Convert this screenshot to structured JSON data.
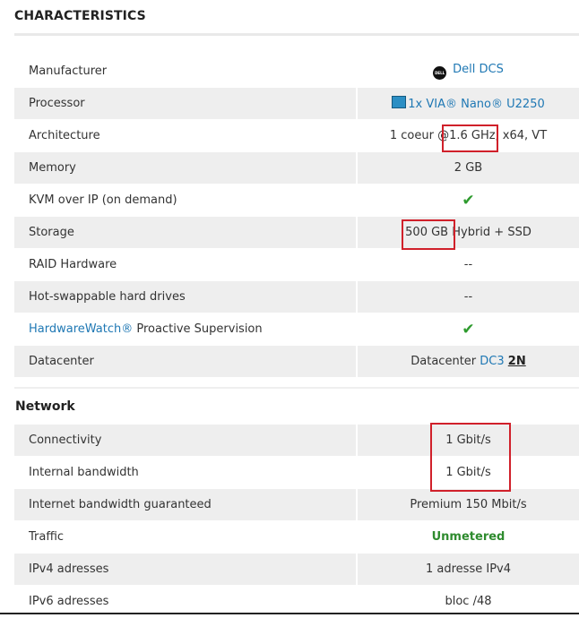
{
  "title": "CHARACTERISTICS",
  "specs": [
    {
      "label": "Manufacturer",
      "value": "Dell DCS"
    },
    {
      "label": "Processor",
      "value": "1x VIA® Nano® U2250"
    },
    {
      "label": "Architecture",
      "value": "1 coeur @1.6 GHz, x64, VT"
    },
    {
      "label": "Memory",
      "value": "2 GB"
    },
    {
      "label": "KVM over IP (on demand)",
      "value": "✔"
    },
    {
      "label": "Storage",
      "value": "500 GB Hybrid + SSD"
    },
    {
      "label": "RAID Hardware",
      "value": "--"
    },
    {
      "label": "Hot-swappable hard drives",
      "value": "--"
    },
    {
      "label": "Proactive Supervision",
      "link": "HardwareWatch®",
      "value": "✔"
    },
    {
      "label": "Datacenter",
      "value_prefix": "Datacenter",
      "link": "DC3",
      "suffix": "2N"
    }
  ],
  "network_title": "Network",
  "network": [
    {
      "label": "Connectivity",
      "value": "1 Gbit/s"
    },
    {
      "label": "Internal bandwidth",
      "value": "1 Gbit/s"
    },
    {
      "label": "Internet bandwidth guaranteed",
      "value": "Premium 150 Mbit/s"
    },
    {
      "label": "Traffic",
      "value": "Unmetered"
    },
    {
      "label": "IPv4 adresses",
      "value": "1 adresse IPv4"
    },
    {
      "label": "IPv6 adresses",
      "value": "bloc /48"
    }
  ],
  "icons": {
    "manufacturer_logo": "dell-logo-icon",
    "processor": "cpu-chip-icon",
    "available": "check-icon"
  },
  "colors": {
    "link": "#1f78b4",
    "check": "#2e9b2e",
    "highlight_box": "#d0202a",
    "row_alt": "#eeeeee"
  }
}
